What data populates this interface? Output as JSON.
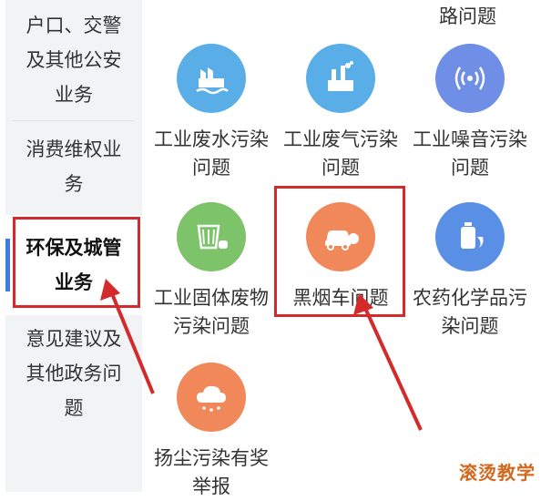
{
  "sidebar": {
    "items": [
      {
        "label": "户口、交警及其他公安业务"
      },
      {
        "label": "消费维权业务"
      },
      {
        "label": "环保及城管业务"
      },
      {
        "label": "意见建议及其他政务问题"
      }
    ],
    "indicator_color": "#3b7ee0"
  },
  "grid": {
    "top_partial_label": "路问题",
    "items": [
      {
        "label": "工业废水污染问题",
        "icon": "factory-water-icon",
        "color": "#5aaee8"
      },
      {
        "label": "工业废气污染问题",
        "icon": "factory-smoke-icon",
        "color": "#5aaee8"
      },
      {
        "label": "工业噪音污染问题",
        "icon": "noise-wave-icon",
        "color": "#6f8fe6"
      },
      {
        "label": "工业固体废物污染问题",
        "icon": "waste-bin-icon",
        "color": "#7cc36a"
      },
      {
        "label": "黑烟车问题",
        "icon": "smoke-car-icon",
        "color": "#f0885a"
      },
      {
        "label": "农药化学品污染问题",
        "icon": "chemical-bottle-icon",
        "color": "#5a8fe6"
      },
      {
        "label": "扬尘污染有奖举报",
        "icon": "dust-cloud-icon",
        "color": "#f0885a"
      }
    ]
  },
  "highlight_color": "#d32b2b",
  "watermark": "滚烫教学"
}
